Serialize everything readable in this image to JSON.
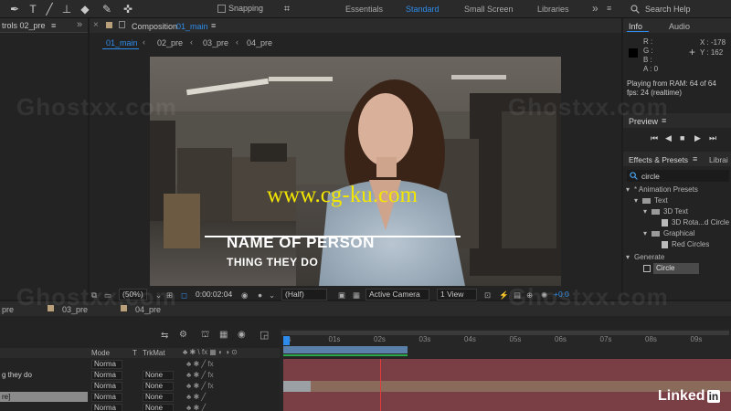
{
  "toolbar": {
    "snapping_label": "Snapping",
    "workspaces": [
      "Essentials",
      "Standard",
      "Small Screen",
      "Libraries"
    ],
    "active_workspace": "Standard",
    "search_placeholder": "Search Help"
  },
  "left_panel": {
    "tab_label": "trols 02_pre"
  },
  "composition": {
    "tab_prefix": "Composition",
    "tab_name": "01_main",
    "breadcrumbs": [
      "01_main",
      "02_pre",
      "03_pre",
      "04_pre"
    ],
    "lower_third": {
      "name": "NAME OF PERSON",
      "role": "THING THEY DO"
    },
    "watermark_center": "www.cg-ku.com",
    "footer": {
      "zoom": "(50%)",
      "timecode": "0:00:02:04",
      "resolution": "(Half)",
      "camera": "Active Camera",
      "view": "1 View",
      "exposure": "+0.0"
    }
  },
  "info": {
    "tabs": [
      "Info",
      "Audio"
    ],
    "channels": [
      {
        "label": "R :",
        "value": ""
      },
      {
        "label": "G :",
        "value": ""
      },
      {
        "label": "B :",
        "value": ""
      },
      {
        "label": "A :",
        "value": "0"
      }
    ],
    "x": "X : -178",
    "y": "Y : 162",
    "status_line1": "Playing from RAM: 64 of 64",
    "status_line2": "fps: 24 (realtime)"
  },
  "preview": {
    "title": "Preview"
  },
  "effects": {
    "tabs": [
      "Effects & Presets",
      "Librai"
    ],
    "search_value": "circle",
    "tree": [
      {
        "label": "* Animation Presets",
        "level": 0,
        "kind": "folder"
      },
      {
        "label": "Text",
        "level": 1,
        "kind": "folder"
      },
      {
        "label": "3D Text",
        "level": 2,
        "kind": "folder"
      },
      {
        "label": "3D Rota...d Circle",
        "level": 3,
        "kind": "file"
      },
      {
        "label": "Graphical",
        "level": 2,
        "kind": "folder"
      },
      {
        "label": "Red Circles",
        "level": 3,
        "kind": "file"
      },
      {
        "label": "Generate",
        "level": 0,
        "kind": "folder"
      },
      {
        "label": "Circle",
        "level": 1,
        "kind": "effect"
      }
    ]
  },
  "timeline": {
    "tabs": [
      "pre",
      "03_pre",
      "04_pre"
    ],
    "columns": {
      "mode": "Mode",
      "t": "T",
      "trkmat": "TrkMat"
    },
    "layers": [
      {
        "name": "",
        "mode": "Norma",
        "trkmat": ""
      },
      {
        "name": "g they do",
        "mode": "Norma",
        "trkmat": "None"
      },
      {
        "name": "",
        "mode": "Norma",
        "trkmat": "None"
      },
      {
        "name": "re]",
        "mode": "Norma",
        "trkmat": "None"
      },
      {
        "name": "",
        "mode": "Norma",
        "trkmat": "None"
      }
    ],
    "ruler": [
      "0s",
      "01s",
      "02s",
      "03s",
      "04s",
      "05s",
      "06s",
      "07s",
      "08s",
      "09s"
    ]
  },
  "watermarks": [
    "Ghostxx.com",
    "Ghostxx.com",
    "Ghostxx.com",
    "Ghostxx.com"
  ],
  "branding": {
    "linkedin_text": "Linked",
    "linkedin_badge": "in"
  },
  "colors": {
    "accent": "#2d8ceb",
    "panel_bg": "#232323",
    "layer_red": "#8c4a4a",
    "work_area": "#6c8db0",
    "lower_third_line": "#ffffff",
    "watermark_yellow": "#f2e600"
  }
}
